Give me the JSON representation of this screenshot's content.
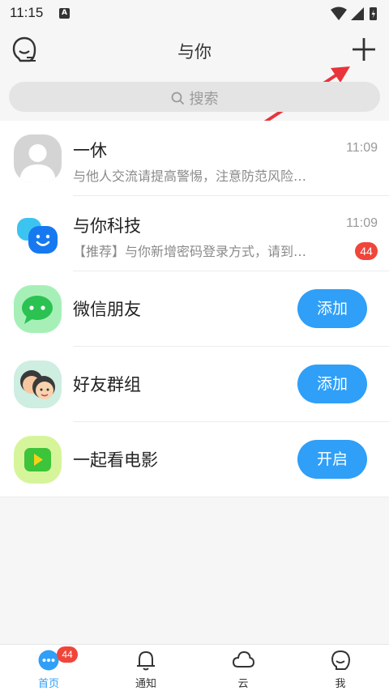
{
  "status_bar": {
    "time": "11:15",
    "notif_letter": "A"
  },
  "header": {
    "title": "与你",
    "profile_icon": "profile-face-icon",
    "plus_icon": "plus-icon"
  },
  "search": {
    "placeholder": "搜索",
    "icon": "search-icon"
  },
  "conversations": [
    {
      "name": "一休",
      "time": "11:09",
      "message": "与他人交流请提高警惕，注意防范风险…",
      "avatar": "default-user-avatar"
    },
    {
      "name": "与你科技",
      "time": "11:09",
      "message": "【推荐】与你新增密码登录方式，请到…",
      "badge": "44",
      "avatar": "yuni-logo"
    }
  ],
  "features": [
    {
      "name": "微信朋友",
      "button": "添加",
      "icon": "wechat-icon"
    },
    {
      "name": "好友群组",
      "button": "添加",
      "icon": "group-faces-icon"
    },
    {
      "name": "一起看电影",
      "button": "开启",
      "icon": "video-play-icon"
    }
  ],
  "tabbar": {
    "tabs": [
      {
        "label": "首页",
        "badge": "44",
        "icon": "chat-bubble-icon",
        "active": true
      },
      {
        "label": "通知",
        "icon": "bell-icon"
      },
      {
        "label": "云",
        "icon": "cloud-icon"
      },
      {
        "label": "我",
        "icon": "profile-icon"
      }
    ]
  },
  "colors": {
    "accent": "#2f9ff8",
    "badge": "#f0453a",
    "arrow": "#e8343a"
  }
}
